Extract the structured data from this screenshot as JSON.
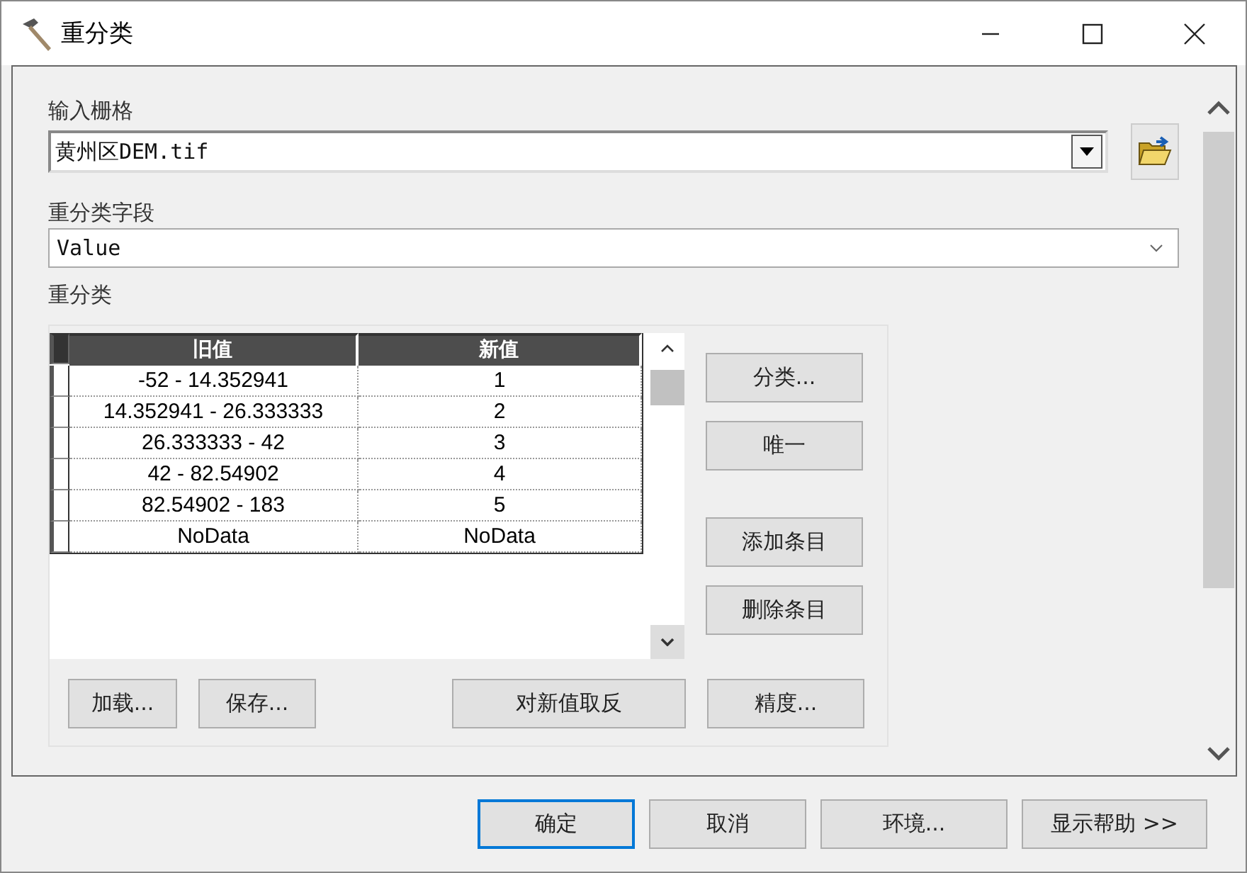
{
  "window": {
    "title": "重分类"
  },
  "input_raster": {
    "label": "输入栅格",
    "value": "黄州区DEM.tif"
  },
  "reclass_field": {
    "label": "重分类字段",
    "value": "Value"
  },
  "reclassification": {
    "label": "重分类",
    "columns": [
      "旧值",
      "新值"
    ],
    "rows": [
      {
        "old": "-52 - 14.352941",
        "new": "1"
      },
      {
        "old": "14.352941 - 26.333333",
        "new": "2"
      },
      {
        "old": "26.333333 - 42",
        "new": "3"
      },
      {
        "old": "42 - 82.54902",
        "new": "4"
      },
      {
        "old": "82.54902 - 183",
        "new": "5"
      },
      {
        "old": "NoData",
        "new": "NoData"
      }
    ],
    "side_buttons": [
      "分类...",
      "唯一",
      "添加条目",
      "删除条目"
    ],
    "bottom_buttons": [
      "加载...",
      "保存...",
      "对新值取反",
      "精度..."
    ]
  },
  "footer_buttons": [
    {
      "label": "确定",
      "focused": true
    },
    {
      "label": "取消",
      "focused": false
    },
    {
      "label": "环境...",
      "focused": false
    },
    {
      "label": "显示帮助 >>",
      "focused": false
    }
  ]
}
